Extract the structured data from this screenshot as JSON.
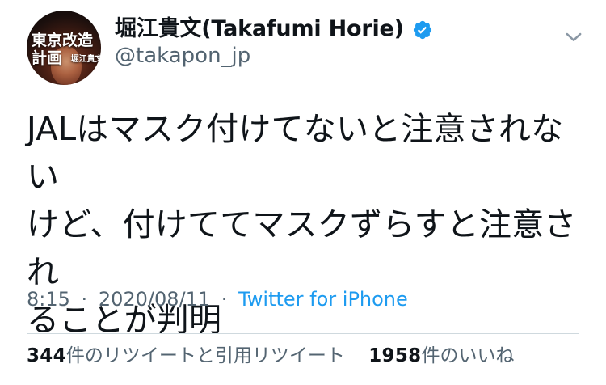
{
  "tweet": {
    "author": {
      "display_name": "堀江貴文(Takafumi Horie)",
      "handle": "@takapon_jp",
      "verified": true,
      "avatar_text_line1": "東京改造",
      "avatar_text_line2": "計画",
      "avatar_text_small": "堀江貴文"
    },
    "text_lines": [
      "JALはマスク付けてないと注意されない",
      "けど、付けててマスクずらすと注意され",
      "ることが判明"
    ],
    "meta": {
      "time": "8:15",
      "separator": "·",
      "date": "2020/08/11",
      "source": "Twitter for iPhone"
    },
    "stats": {
      "retweets_count": "344",
      "retweets_label": "件のリツイートと引用リツイート",
      "likes_count": "1958",
      "likes_label": "件のいいね"
    },
    "icons": {
      "verified": "verified-icon",
      "more": "chevron-down-icon"
    },
    "colors": {
      "verified": "#1d9bf0",
      "link": "#1d9bf0",
      "secondary_text": "#536471",
      "primary_text": "#0f1419",
      "divider": "#cfd9de"
    }
  }
}
